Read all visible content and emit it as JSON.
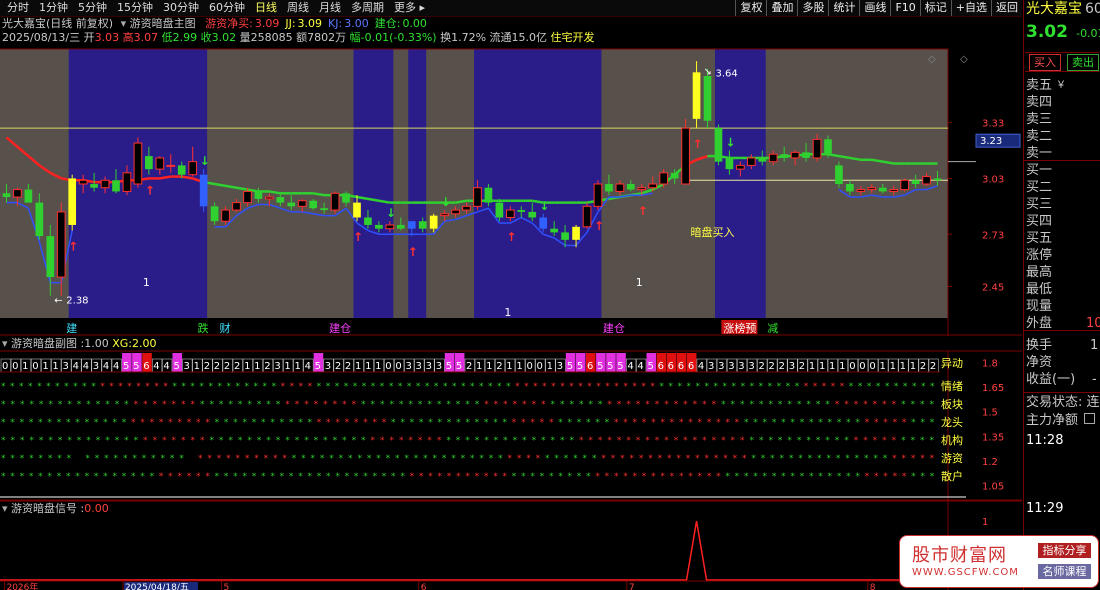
{
  "toolbar": {
    "periods": [
      "分时",
      "1分钟",
      "5分钟",
      "15分钟",
      "30分钟",
      "60分钟",
      "日线",
      "周线",
      "月线",
      "多周期",
      "更多"
    ],
    "active_period": "日线",
    "right_tools": [
      "复权",
      "叠加",
      "多股",
      "统计",
      "画线",
      "F10",
      "标记",
      "+自选",
      "返回"
    ]
  },
  "title_row": {
    "stock_name": "光大嘉宝(日线 前复权)",
    "indicator_name": "游资暗盘主图",
    "vals": [
      {
        "label": "游资净买:",
        "value": "3.09",
        "color": "#ff4040"
      },
      {
        "label": "JJ:",
        "value": "3.09",
        "color": "#ffff40"
      },
      {
        "label": "KJ:",
        "value": "3.00",
        "color": "#5a78ff"
      },
      {
        "label": "建仓:",
        "value": "0.00",
        "color": "#30e030"
      }
    ]
  },
  "info_row": {
    "date": "2025/08/13/三",
    "open_label": "开",
    "open": "3.03",
    "high_label": "高",
    "high": "3.07",
    "low_label": "低",
    "low": "2.99",
    "close_label": "收",
    "close": "3.02",
    "vol_label": "量",
    "vol": "258085",
    "amount_label": "额",
    "amount": "7802万",
    "change_label": "幅",
    "change": "-0.01(-0.33%)",
    "turnover_label": "换",
    "turnover": "1.72%",
    "float_label": "流通",
    "float": "15.0亿",
    "sector": "住宅开发"
  },
  "chart_data": [
    {
      "type": "candlestick",
      "title": "游资暗盘主图",
      "yticks": [
        3.33,
        3.03,
        2.73,
        2.45
      ],
      "ylim": [
        2.28,
        3.72
      ],
      "price_line": 3.23,
      "price_line_label": "3.23",
      "hline_low": 3.02,
      "max_label": "3.64",
      "min_label": "2.38",
      "hline_yellow": 3.3,
      "candles": [
        {
          "o": 2.95,
          "h": 3.0,
          "l": 2.9,
          "c": 2.93
        },
        {
          "o": 2.93,
          "h": 2.98,
          "l": 2.88,
          "c": 2.97
        },
        {
          "o": 2.97,
          "h": 3.0,
          "l": 2.93,
          "c": 2.9
        },
        {
          "o": 2.9,
          "h": 2.95,
          "l": 2.7,
          "c": 2.72
        },
        {
          "o": 2.72,
          "h": 2.78,
          "l": 2.4,
          "c": 2.5
        },
        {
          "o": 2.5,
          "h": 2.9,
          "l": 2.4,
          "c": 2.85
        },
        {
          "o": 2.78,
          "h": 3.05,
          "l": 2.75,
          "c": 3.03
        },
        {
          "o": 3.0,
          "h": 3.05,
          "l": 2.95,
          "c": 3.02
        },
        {
          "o": 3.0,
          "h": 3.06,
          "l": 2.96,
          "c": 2.98
        },
        {
          "o": 2.98,
          "h": 3.04,
          "l": 2.95,
          "c": 3.02
        },
        {
          "o": 3.02,
          "h": 3.08,
          "l": 2.95,
          "c": 2.96
        },
        {
          "o": 2.96,
          "h": 3.1,
          "l": 2.94,
          "c": 3.06
        },
        {
          "o": 3.0,
          "h": 3.25,
          "l": 2.98,
          "c": 3.22
        },
        {
          "o": 3.15,
          "h": 3.2,
          "l": 3.05,
          "c": 3.08
        },
        {
          "o": 3.08,
          "h": 3.15,
          "l": 3.05,
          "c": 3.14
        },
        {
          "o": 3.1,
          "h": 3.16,
          "l": 3.06,
          "c": 3.1
        },
        {
          "o": 3.1,
          "h": 3.12,
          "l": 3.03,
          "c": 3.05
        },
        {
          "o": 3.05,
          "h": 3.2,
          "l": 3.04,
          "c": 3.12
        },
        {
          "o": 3.05,
          "h": 3.08,
          "l": 2.85,
          "c": 2.88
        },
        {
          "o": 2.88,
          "h": 2.9,
          "l": 2.78,
          "c": 2.8
        },
        {
          "o": 2.8,
          "h": 2.88,
          "l": 2.78,
          "c": 2.86
        },
        {
          "o": 2.86,
          "h": 2.92,
          "l": 2.85,
          "c": 2.9
        },
        {
          "o": 2.9,
          "h": 2.98,
          "l": 2.88,
          "c": 2.96
        },
        {
          "o": 2.96,
          "h": 2.98,
          "l": 2.9,
          "c": 2.92
        },
        {
          "o": 2.92,
          "h": 2.95,
          "l": 2.88,
          "c": 2.93
        },
        {
          "o": 2.93,
          "h": 2.95,
          "l": 2.88,
          "c": 2.9
        },
        {
          "o": 2.9,
          "h": 2.94,
          "l": 2.86,
          "c": 2.88
        },
        {
          "o": 2.88,
          "h": 2.92,
          "l": 2.85,
          "c": 2.91
        },
        {
          "o": 2.91,
          "h": 2.92,
          "l": 2.86,
          "c": 2.87
        },
        {
          "o": 2.87,
          "h": 2.9,
          "l": 2.84,
          "c": 2.86
        },
        {
          "o": 2.86,
          "h": 2.96,
          "l": 2.84,
          "c": 2.95
        },
        {
          "o": 2.95,
          "h": 2.96,
          "l": 2.88,
          "c": 2.9
        },
        {
          "o": 2.9,
          "h": 2.94,
          "l": 2.8,
          "c": 2.82
        },
        {
          "o": 2.82,
          "h": 2.86,
          "l": 2.76,
          "c": 2.78
        },
        {
          "o": 2.78,
          "h": 2.8,
          "l": 2.74,
          "c": 2.76
        },
        {
          "o": 2.76,
          "h": 2.8,
          "l": 2.74,
          "c": 2.78
        },
        {
          "o": 2.78,
          "h": 2.82,
          "l": 2.75,
          "c": 2.76
        },
        {
          "o": 2.76,
          "h": 2.8,
          "l": 2.72,
          "c": 2.8
        },
        {
          "o": 2.8,
          "h": 2.82,
          "l": 2.74,
          "c": 2.76
        },
        {
          "o": 2.76,
          "h": 2.84,
          "l": 2.74,
          "c": 2.83
        },
        {
          "o": 2.83,
          "h": 2.86,
          "l": 2.8,
          "c": 2.84
        },
        {
          "o": 2.84,
          "h": 2.88,
          "l": 2.82,
          "c": 2.86
        },
        {
          "o": 2.86,
          "h": 2.9,
          "l": 2.84,
          "c": 2.88
        },
        {
          "o": 2.88,
          "h": 3.02,
          "l": 2.86,
          "c": 2.98
        },
        {
          "o": 2.98,
          "h": 3.0,
          "l": 2.88,
          "c": 2.9
        },
        {
          "o": 2.9,
          "h": 2.92,
          "l": 2.8,
          "c": 2.82
        },
        {
          "o": 2.82,
          "h": 2.88,
          "l": 2.8,
          "c": 2.86
        },
        {
          "o": 2.86,
          "h": 2.88,
          "l": 2.82,
          "c": 2.85
        },
        {
          "o": 2.85,
          "h": 2.9,
          "l": 2.8,
          "c": 2.82
        },
        {
          "o": 2.82,
          "h": 2.84,
          "l": 2.74,
          "c": 2.76
        },
        {
          "o": 2.76,
          "h": 2.8,
          "l": 2.72,
          "c": 2.74
        },
        {
          "o": 2.74,
          "h": 2.78,
          "l": 2.66,
          "c": 2.7
        },
        {
          "o": 2.7,
          "h": 2.78,
          "l": 2.66,
          "c": 2.77
        },
        {
          "o": 2.77,
          "h": 2.9,
          "l": 2.76,
          "c": 2.88
        },
        {
          "o": 2.88,
          "h": 3.02,
          "l": 2.86,
          "c": 3.0
        },
        {
          "o": 3.0,
          "h": 3.05,
          "l": 2.94,
          "c": 2.96
        },
        {
          "o": 2.96,
          "h": 3.02,
          "l": 2.94,
          "c": 3.0
        },
        {
          "o": 3.0,
          "h": 3.02,
          "l": 2.96,
          "c": 2.97
        },
        {
          "o": 2.97,
          "h": 3.0,
          "l": 2.94,
          "c": 2.98
        },
        {
          "o": 2.98,
          "h": 3.04,
          "l": 2.96,
          "c": 3.0
        },
        {
          "o": 3.0,
          "h": 3.08,
          "l": 2.98,
          "c": 3.06
        },
        {
          "o": 3.06,
          "h": 3.08,
          "l": 3.0,
          "c": 3.03
        },
        {
          "o": 3.0,
          "h": 3.35,
          "l": 3.0,
          "c": 3.3
        },
        {
          "o": 3.35,
          "h": 3.66,
          "l": 3.3,
          "c": 3.6
        },
        {
          "o": 3.58,
          "h": 3.62,
          "l": 3.3,
          "c": 3.34
        },
        {
          "o": 3.3,
          "h": 3.32,
          "l": 3.1,
          "c": 3.12
        },
        {
          "o": 3.14,
          "h": 3.18,
          "l": 3.05,
          "c": 3.08
        },
        {
          "o": 3.08,
          "h": 3.12,
          "l": 3.04,
          "c": 3.1
        },
        {
          "o": 3.1,
          "h": 3.16,
          "l": 3.08,
          "c": 3.14
        },
        {
          "o": 3.14,
          "h": 3.18,
          "l": 3.1,
          "c": 3.12
        },
        {
          "o": 3.12,
          "h": 3.18,
          "l": 3.1,
          "c": 3.16
        },
        {
          "o": 3.16,
          "h": 3.2,
          "l": 3.12,
          "c": 3.14
        },
        {
          "o": 3.14,
          "h": 3.18,
          "l": 3.1,
          "c": 3.17
        },
        {
          "o": 3.17,
          "h": 3.22,
          "l": 3.12,
          "c": 3.14
        },
        {
          "o": 3.14,
          "h": 3.27,
          "l": 3.12,
          "c": 3.24
        },
        {
          "o": 3.24,
          "h": 3.26,
          "l": 3.14,
          "c": 3.16
        },
        {
          "o": 3.1,
          "h": 3.12,
          "l": 2.98,
          "c": 3.0
        },
        {
          "o": 3.0,
          "h": 3.02,
          "l": 2.94,
          "c": 2.96
        },
        {
          "o": 2.96,
          "h": 2.99,
          "l": 2.94,
          "c": 2.97
        },
        {
          "o": 2.97,
          "h": 3.0,
          "l": 2.95,
          "c": 2.98
        },
        {
          "o": 2.98,
          "h": 3.0,
          "l": 2.95,
          "c": 2.96
        },
        {
          "o": 2.96,
          "h": 2.99,
          "l": 2.94,
          "c": 2.97
        },
        {
          "o": 2.97,
          "h": 3.03,
          "l": 2.96,
          "c": 3.02
        },
        {
          "o": 3.02,
          "h": 3.05,
          "l": 2.98,
          "c": 3.0
        },
        {
          "o": 3.0,
          "h": 3.06,
          "l": 2.99,
          "c": 3.04
        },
        {
          "o": 3.03,
          "h": 3.07,
          "l": 2.99,
          "c": 3.02
        }
      ],
      "ma_points": [
        3.25,
        3.2,
        3.15,
        3.1,
        3.06,
        3.03,
        3.02,
        3.02,
        3.01,
        3.01,
        3.01,
        3.02,
        3.02,
        3.03,
        3.03,
        3.04,
        3.04,
        3.03,
        3.01,
        3.0,
        2.99,
        2.98,
        2.97,
        2.96,
        2.96,
        2.95,
        2.95,
        2.95,
        2.95,
        2.94,
        2.94,
        2.94,
        2.93,
        2.92,
        2.91,
        2.9,
        2.9,
        2.9,
        2.9,
        2.9,
        2.9,
        2.9,
        2.91,
        2.91,
        2.91,
        2.91,
        2.91,
        2.91,
        2.91,
        2.9,
        2.9,
        2.9,
        2.9,
        2.9,
        2.91,
        2.92,
        2.93,
        2.94,
        2.95,
        2.97,
        3.0,
        3.05,
        3.1,
        3.13,
        3.15,
        3.15,
        3.14,
        3.14,
        3.14,
        3.14,
        3.14,
        3.15,
        3.15,
        3.16,
        3.16,
        3.16,
        3.15,
        3.14,
        3.13,
        3.13,
        3.12,
        3.11,
        3.11,
        3.11,
        3.11,
        3.11
      ],
      "shade_zones": [
        [
          6,
          18
        ],
        [
          32,
          35
        ],
        [
          37,
          38
        ],
        [
          43,
          54
        ],
        [
          65,
          69
        ]
      ],
      "big_candles": [
        {
          "i": 6,
          "color": "#ffff20"
        },
        {
          "i": 18,
          "color": "#3060ff"
        },
        {
          "i": 32,
          "color": "#ffff20"
        },
        {
          "i": 37,
          "color": "#3060ff"
        },
        {
          "i": 39,
          "color": "#ffff20"
        },
        {
          "i": 49,
          "color": "#3060ff"
        },
        {
          "i": 52,
          "color": "#ffff20"
        },
        {
          "i": 63,
          "color": "#ffff20"
        }
      ],
      "red_arrows": [
        6,
        13,
        32,
        37,
        46,
        54,
        58,
        63
      ],
      "green_arrows": [
        18,
        35,
        40,
        49,
        66
      ],
      "annotations": [
        {
          "i": 13,
          "text": "1",
          "color": "#ffffff",
          "pos": "low"
        },
        {
          "i": 46,
          "text": "1",
          "color": "#ffffff",
          "pos": "bot"
        },
        {
          "i": 58,
          "text": "1",
          "color": "#ffffff",
          "pos": "low"
        },
        {
          "i": 63,
          "text": "暗盘买入",
          "color": "#ffff40",
          "pos": "mid"
        }
      ],
      "bottom_labels": [
        {
          "i": 6,
          "text": "建",
          "color": "#40e0ff"
        },
        {
          "i": 18,
          "text": "跌",
          "color": "#30e030"
        },
        {
          "i": 20,
          "text": "财",
          "color": "#40e0ff"
        },
        {
          "i": 30,
          "text": "建仓",
          "color": "#ff40ff"
        },
        {
          "i": 55,
          "text": "建仓",
          "color": "#ff40ff"
        },
        {
          "i": 66,
          "text": "涨榜预",
          "color": "#ffffff",
          "bg": "#c81010"
        },
        {
          "i": 70,
          "text": "减",
          "color": "#30e030"
        }
      ]
    },
    {
      "type": "table",
      "title": "游资暗盘副图",
      "params": [
        {
          "label": "游资暗盘副图",
          "value": "1.00"
        },
        {
          "label": "XG:",
          "value": "2.00"
        }
      ],
      "yticks": [
        1.8,
        1.65,
        1.5,
        1.35,
        1.2,
        1.05
      ],
      "ylim": [
        0.98,
        1.87
      ],
      "row_labels": [
        "异动",
        "情绪",
        "板块",
        "龙头",
        "机构",
        "游资",
        "散户"
      ],
      "yidong_values": [
        0,
        0,
        1,
        0,
        1,
        1,
        3,
        4,
        4,
        3,
        4,
        4,
        5,
        5,
        6,
        4,
        4,
        5,
        3,
        1,
        2,
        2,
        2,
        2,
        1,
        1,
        2,
        3,
        1,
        1,
        4,
        5,
        3,
        2,
        2,
        1,
        1,
        1,
        0,
        0,
        3,
        3,
        3,
        3,
        5,
        5,
        2,
        1,
        1,
        2,
        1,
        1,
        0,
        0,
        1,
        3,
        5,
        5,
        6,
        5,
        5,
        5,
        4,
        4,
        5,
        6,
        6,
        6,
        6,
        4,
        3,
        3,
        3,
        3,
        3,
        2,
        2,
        2,
        3,
        2,
        1,
        1,
        1,
        1,
        0,
        0,
        0,
        1,
        1,
        1,
        1,
        2,
        2
      ],
      "grid_rows": [
        "GGGGGGGGGGGRRRRRRRRGGGGGGGGGGGGRRRRGGGGGGGGGGGGGGGGGGGGGGRRRRRRRRRRRRRRRRGGGGGGGGGGGGGGGGRRRRRGGGGGGGGGG",
        "GGGGGGGGGGGGGGRRRRRRRGGGGGGGGGRRRRRRRRGGGGGGGGGGGGGRRRRRRRGGGGGGRRRRRRRRRRRRGGGGGGGGGGGGRRRRRRRGGGG",
        "GGGGGGGGGGGGGGRRRRRRRRRGGGGGGGGGGGRRRRRRRRGGGGGGGGGGGGGRRRRRGGGGGGRRRRRRRRRRRRRRGGGGGGGGGGGGGRRRRRGGG",
        "GGGGGGGGGGGGGGGRRRRRRRGGGGGGGGGGGGGGGGGRRRRRRRRGGGGGGGGGGGGGGRRRRRRRRRRRRRRRRRRGGGGGGGGGGGRRRRRGGGG",
        "GGGGGGGG.GGGGGGGGGGG.RRRRRRRRRRGGGGGGGGGGGGGGGGGGGGGGGRRRRGGGGGGRRRRRRRRRRRRRRRRGGGGGGGGGGGGGGGRRRRR",
        "GGGGGGGGGGGGGGGGGRRRRRRGGGGGGGGGGGGGGGGGGGGGRRRRRRRRRRRGGGGGGGGGRRRRRRRRRRRRRRGGGGGGGGGGGGGGGRRRRRGGG"
      ]
    },
    {
      "type": "line",
      "title": "游资暗盘信号",
      "value": "0.00",
      "yticks": [
        1.0
      ],
      "ylim": [
        0,
        1.05
      ],
      "spike_at": 63
    }
  ],
  "dates": [
    {
      "i": 0,
      "text": "2026年"
    },
    {
      "i": 11,
      "text": "2025/04/18/五",
      "hl": true
    },
    {
      "i": 20,
      "text": "5"
    },
    {
      "i": 38,
      "text": "6"
    },
    {
      "i": 57,
      "text": "7"
    },
    {
      "i": 79,
      "text": "8"
    }
  ],
  "right_panel": {
    "name": "光大嘉宝",
    "code_partial": "60",
    "price": "3.02",
    "change": "-0.01",
    "buy_btn": "买入",
    "sell_btn": "卖出",
    "levels": [
      "卖五",
      "卖四",
      "卖三",
      "卖二",
      "卖一",
      "买一",
      "买二",
      "买三",
      "买四",
      "买五"
    ],
    "levels_extra": "￥",
    "stats": [
      "涨停",
      "最高",
      "最低",
      "现量",
      "外盘"
    ],
    "waipan_val": "10",
    "stats2": [
      "换手",
      "净资",
      "收益(一)"
    ],
    "huanshou_val": "1",
    "shouyi_val": "-",
    "trade_status": "交易状态: 连",
    "main_force": "主力净额",
    "times": [
      "11:28",
      "11:29"
    ]
  },
  "watermark": {
    "title": "股市财富网",
    "url": "WWW.GSCFW.COM",
    "tag1": "指标分享",
    "tag2": "名师课程"
  }
}
